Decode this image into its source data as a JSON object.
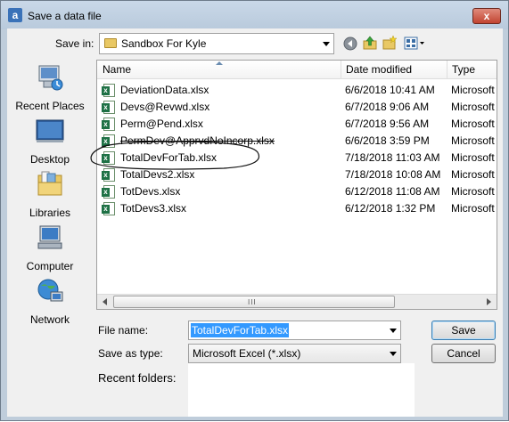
{
  "window": {
    "title": "Save a data file",
    "app_icon_letter": "a",
    "close_symbol": "x"
  },
  "toolbar": {
    "save_in_label": "Save in:",
    "save_in_value": "Sandbox For Kyle",
    "icons": [
      "back-icon",
      "up-folder-icon",
      "new-folder-icon",
      "view-menu-icon"
    ]
  },
  "places": [
    {
      "label": "Recent Places",
      "icon": "recent-places-icon"
    },
    {
      "label": "Desktop",
      "icon": "desktop-icon"
    },
    {
      "label": "Libraries",
      "icon": "libraries-icon"
    },
    {
      "label": "Computer",
      "icon": "computer-icon"
    },
    {
      "label": "Network",
      "icon": "network-icon"
    }
  ],
  "columns": {
    "name": "Name",
    "date": "Date modified",
    "type": "Type"
  },
  "files": [
    {
      "name": "DeviationData.xlsx",
      "date": "6/6/2018 10:41 AM",
      "type": "Microsoft"
    },
    {
      "name": "Devs@Revwd.xlsx",
      "date": "6/7/2018 9:06 AM",
      "type": "Microsoft"
    },
    {
      "name": "Perm@Pend.xlsx",
      "date": "6/7/2018 9:56 AM",
      "type": "Microsoft"
    },
    {
      "name": "PermDev@ApprvdNoIncorp.xlsx",
      "date": "6/6/2018 3:59 PM",
      "type": "Microsoft"
    },
    {
      "name": "TotalDevForTab.xlsx",
      "date": "7/18/2018 11:03 AM",
      "type": "Microsoft"
    },
    {
      "name": "TotalDevs2.xlsx",
      "date": "7/18/2018 10:08 AM",
      "type": "Microsoft"
    },
    {
      "name": "TotDevs.xlsx",
      "date": "6/12/2018 11:08 AM",
      "type": "Microsoft"
    },
    {
      "name": "TotDevs3.xlsx",
      "date": "6/12/2018 1:32 PM",
      "type": "Microsoft"
    }
  ],
  "form": {
    "file_name_label": "File name:",
    "file_name_value": "TotalDevForTab.xlsx",
    "save_type_label": "Save as type:",
    "save_type_value": "Microsoft Excel (*.xlsx)",
    "save_button": "Save",
    "cancel_button": "Cancel",
    "recent_folders_label": "Recent folders:"
  },
  "scrollbar": {
    "grip": "III"
  },
  "colors": {
    "selection": "#3399ff",
    "titlebar": "#c9d8e8",
    "excel_green": "#1e7145"
  }
}
